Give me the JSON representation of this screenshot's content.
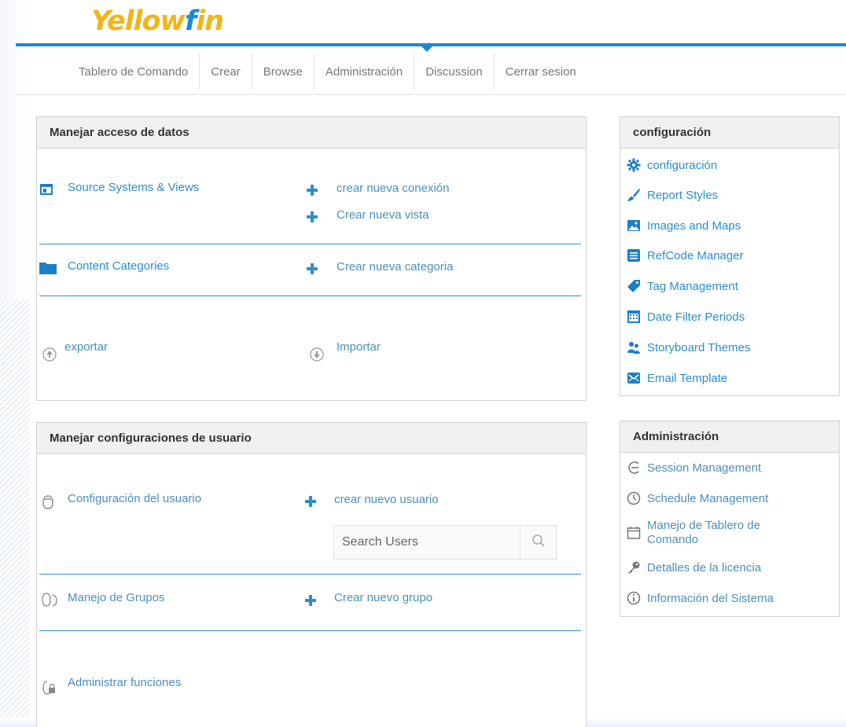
{
  "brand": {
    "logo_part1": "Yellow",
    "logo_part2": "f",
    "logo_part3": "in"
  },
  "nav": {
    "items": [
      {
        "label": "Tablero de Comando"
      },
      {
        "label": "Crear"
      },
      {
        "label": "Browse"
      },
      {
        "label": "Administración"
      },
      {
        "label": "Discussion"
      },
      {
        "label": "Cerrar sesion"
      }
    ]
  },
  "data_access": {
    "title": "Manejar acceso de datos",
    "source_systems": "Source Systems & Views",
    "new_connection": "crear nueva conexión",
    "new_view": "Crear nueva vista",
    "content_categories": "Content Categories",
    "new_category": "Crear nueva categoria",
    "export": "exportar",
    "import": "Importar"
  },
  "user_config": {
    "title": "Manejar configuraciones de usuario",
    "user_settings": "Configuración del usuario",
    "new_user": "crear nuevo usuario",
    "search_placeholder": "Search Users",
    "group_management": "Manejo de Grupos",
    "new_group": "Crear nuevo grupo",
    "manage_roles": "Administrar funciones"
  },
  "config_panel": {
    "title": "configuración",
    "items": [
      {
        "label": "configuración",
        "icon": "gear-icon"
      },
      {
        "label": "Report Styles",
        "icon": "brush-icon"
      },
      {
        "label": "Images and Maps",
        "icon": "image-icon"
      },
      {
        "label": "RefCode Manager",
        "icon": "list-icon"
      },
      {
        "label": "Tag Management",
        "icon": "tag-icon"
      },
      {
        "label": "Date Filter Periods",
        "icon": "calendar-grid-icon"
      },
      {
        "label": "Storyboard Themes",
        "icon": "people-icon"
      },
      {
        "label": "Email Template",
        "icon": "envelope-icon"
      }
    ]
  },
  "admin_panel": {
    "title": "Administración",
    "items": [
      {
        "label": "Session Management",
        "icon": "session-icon"
      },
      {
        "label": "Schedule Management",
        "icon": "clock-icon"
      },
      {
        "label": "Manejo de Tablero de Comando",
        "icon": "calendar-icon"
      },
      {
        "label": "Detalles de la licencia",
        "icon": "key-icon"
      },
      {
        "label": "Información del Sistema",
        "icon": "info-icon"
      }
    ]
  },
  "colors": {
    "accent": "#2a8fcd",
    "logo_yellow": "#f3b516",
    "header_rule": "#1e88cf"
  }
}
